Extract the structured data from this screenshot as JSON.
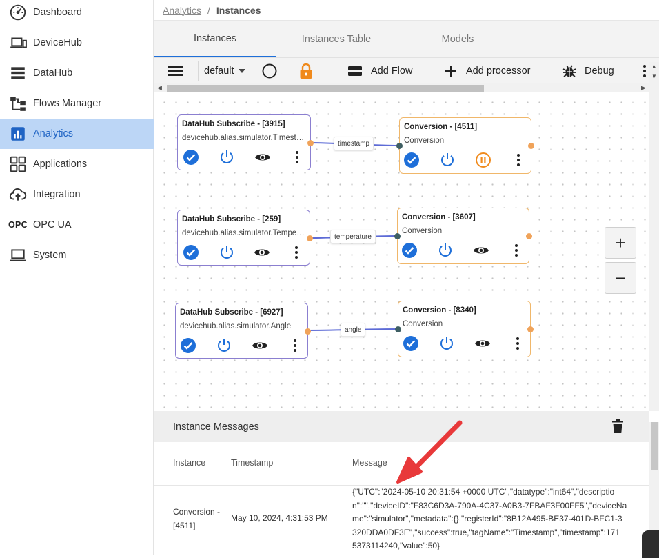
{
  "sidebar": {
    "items": [
      {
        "label": "Dashboard",
        "icon": "gauge-icon"
      },
      {
        "label": "DeviceHub",
        "icon": "devices-icon"
      },
      {
        "label": "DataHub",
        "icon": "server-icon"
      },
      {
        "label": "Flows Manager",
        "icon": "flow-icon"
      },
      {
        "label": "Analytics",
        "icon": "chart-icon",
        "active": true
      },
      {
        "label": "Applications",
        "icon": "apps-grid-icon"
      },
      {
        "label": "Integration",
        "icon": "cloud-upload-icon"
      },
      {
        "label": "OPC UA",
        "icon": "opc-text-icon",
        "icon_text": "OPC"
      },
      {
        "label": "System",
        "icon": "laptop-icon"
      }
    ]
  },
  "breadcrumb": {
    "parent": "Analytics",
    "separator": "/",
    "current": "Instances"
  },
  "tabs": [
    {
      "label": "Instances",
      "active": true
    },
    {
      "label": "Instances Table"
    },
    {
      "label": "Models"
    }
  ],
  "toolbar": {
    "flow_select": "default",
    "add_flow": "Add Flow",
    "add_processor": "Add processor",
    "debug": "Debug"
  },
  "nodes": [
    {
      "title": "DataHub Subscribe - [3915]",
      "subtitle": "devicehub.alias.simulator.Timestamp",
      "status": "running"
    },
    {
      "title": "Conversion - [4511]",
      "subtitle": "Conversion",
      "status": "paused"
    },
    {
      "title": "DataHub Subscribe - [259]",
      "subtitle": "devicehub.alias.simulator.Temperature",
      "status": "running"
    },
    {
      "title": "Conversion - [3607]",
      "subtitle": "Conversion",
      "status": "running"
    },
    {
      "title": "DataHub Subscribe - [6927]",
      "subtitle": "devicehub.alias.simulator.Angle",
      "status": "running"
    },
    {
      "title": "Conversion - [8340]",
      "subtitle": "Conversion",
      "status": "running"
    }
  ],
  "edges": [
    {
      "label": "timestamp"
    },
    {
      "label": "temperature"
    },
    {
      "label": "angle"
    }
  ],
  "zoom": {
    "in": "+",
    "out": "−"
  },
  "messages": {
    "title": "Instance Messages",
    "columns": [
      "Instance",
      "Timestamp",
      "Message"
    ],
    "rows": [
      {
        "instance_line1": "Conversion -",
        "instance_line2": "[4511]",
        "timestamp": "May 10, 2024, 4:31:53 PM",
        "message_lines": [
          "{\"UTC\":\"2024-05-10 20:31:54 +0000 UTC\",\"datatype\":\"int64\",\"descriptio",
          "n\":\"\",\"deviceID\":\"F83C6D3A-790A-4C37-A0B3-7FBAF3F00FF5\",\"deviceNa",
          "me\":\"simulator\",\"metadata\":{},\"registerId\":\"8B12A495-BE37-401D-BFC1-3",
          "320DDA0DF3E\",\"success\":true,\"tagName\":\"Timestamp\",\"timestamp\":171",
          "5373114240,\"value\":50}"
        ]
      }
    ]
  },
  "colors": {
    "accent": "#1e6fd9",
    "active_bg": "#bcd6f6",
    "node_border": "#8b7fd0",
    "node_border_orange": "#f0b76a",
    "port_out": "#f0a35a",
    "lock": "#f08a1c",
    "arrow": "#e8393a"
  }
}
